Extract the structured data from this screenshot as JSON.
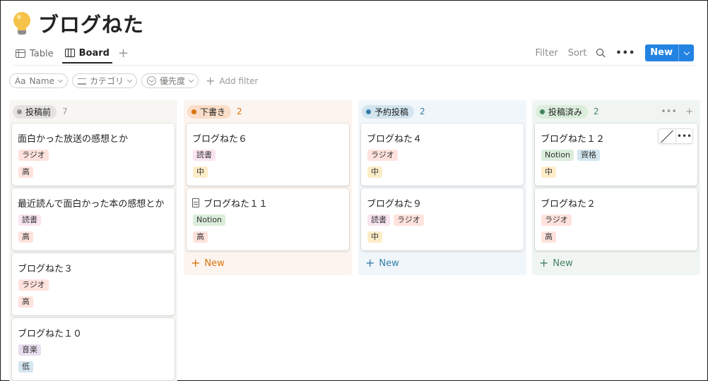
{
  "page": {
    "title": "ブログねた"
  },
  "tabs": [
    {
      "label": "Table"
    },
    {
      "label": "Board"
    }
  ],
  "actions": {
    "filter": "Filter",
    "sort": "Sort",
    "new_label": "New"
  },
  "filters": {
    "name": "Name",
    "category": "カテゴリ",
    "priority": "優先度",
    "add_filter": "Add filter"
  },
  "columns": [
    {
      "label": "投稿前",
      "count": "7",
      "cards": [
        {
          "title": "面白かった放送の感想とか",
          "tags": [
            "ラジオ"
          ],
          "priority": "高"
        },
        {
          "title": "最近読んで面白かった本の感想とか",
          "tags": [
            "読書"
          ],
          "priority": "高"
        },
        {
          "title": "ブログねた３",
          "tags": [
            "ラジオ"
          ],
          "priority": "高"
        },
        {
          "title": "ブログねた１０",
          "tags": [
            "音楽"
          ],
          "priority": "低"
        }
      ]
    },
    {
      "label": "下書き",
      "count": "2",
      "new_label": "New",
      "cards": [
        {
          "title": "ブログねた６",
          "tags": [
            "読書"
          ],
          "priority": "中"
        },
        {
          "title": "ブログねた１１",
          "tags": [
            "Notion"
          ],
          "priority": "高"
        }
      ]
    },
    {
      "label": "予約投稿",
      "count": "2",
      "new_label": "New",
      "cards": [
        {
          "title": "ブログねた４",
          "tags": [
            "ラジオ"
          ],
          "priority": "中"
        },
        {
          "title": "ブログねた９",
          "tags": [
            "読書",
            "ラジオ"
          ],
          "priority": "中"
        }
      ]
    },
    {
      "label": "投稿済み",
      "count": "2",
      "new_label": "New",
      "cards": [
        {
          "title": "ブログねた１２",
          "tags": [
            "Notion",
            "資格"
          ],
          "priority": "中"
        },
        {
          "title": "ブログねた２",
          "tags": [
            "ラジオ"
          ],
          "priority": "高"
        }
      ]
    }
  ],
  "colors": {
    "accent": "#2383e2",
    "col_gray_bg": "#f7f6f3",
    "col_orange_bg": "#fcf4ef",
    "col_blue_bg": "#f1f6fa",
    "col_green_bg": "#f0f5f1",
    "orange": "#d9730d",
    "blue": "#337ea9",
    "green": "#448361",
    "gray": "#9b9a97"
  },
  "icons": [
    "light-bulb-icon",
    "table-icon",
    "board-icon",
    "plus-icon",
    "search-icon",
    "more-icon",
    "chevron-down-icon",
    "text-icon",
    "list-icon",
    "status-icon",
    "edit-icon",
    "page-icon"
  ]
}
